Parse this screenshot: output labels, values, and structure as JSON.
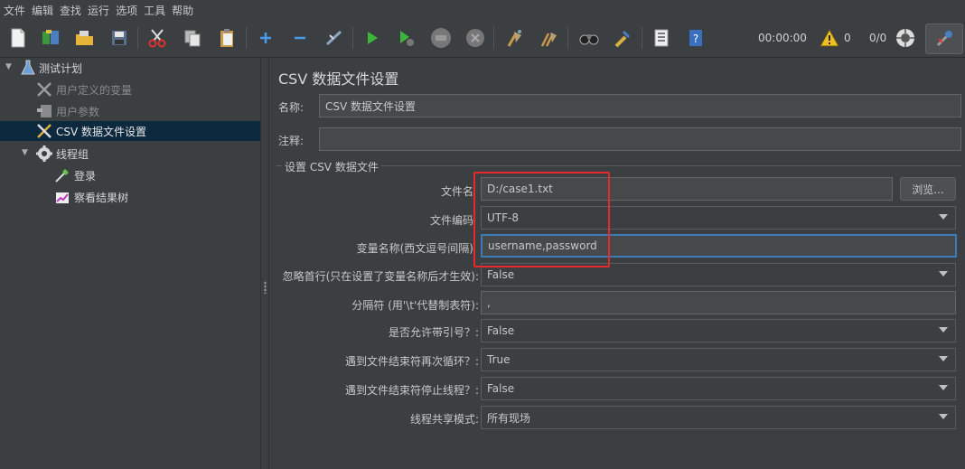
{
  "menu": [
    "文件",
    "编辑",
    "查找",
    "运行",
    "选项",
    "工具",
    "帮助"
  ],
  "toolbar": {
    "timer": "00:00:00",
    "warning_count": "0",
    "thread_count": "0/0"
  },
  "tree": {
    "items": [
      {
        "label": "测试计划"
      },
      {
        "label": "用户定义的变量"
      },
      {
        "label": "用户参数"
      },
      {
        "label": "CSV 数据文件设置"
      },
      {
        "label": "线程组"
      },
      {
        "label": "登录"
      },
      {
        "label": "察看结果树"
      }
    ]
  },
  "panel": {
    "title": "CSV 数据文件设置",
    "name_label": "名称:",
    "name_value": "CSV 数据文件设置",
    "comment_label": "注释:",
    "comment_value": "",
    "group_title": "设置 CSV 数据文件",
    "browse_button": "浏览...",
    "fields": [
      {
        "label": "文件名",
        "value": "D:/case1.txt"
      },
      {
        "label": "文件编码",
        "value": "UTF-8"
      },
      {
        "label": "变量名称(西文逗号间隔)",
        "value": "username,password"
      },
      {
        "label": "忽略首行(只在设置了变量名称后才生效):",
        "value": "False"
      },
      {
        "label": "分隔符 (用'\\t'代替制表符):",
        "value": ","
      },
      {
        "label": "是否允许带引号？:",
        "value": "False"
      },
      {
        "label": "遇到文件结束符再次循环？:",
        "value": "True"
      },
      {
        "label": "遇到文件结束符停止线程？:",
        "value": "False"
      },
      {
        "label": "线程共享模式:",
        "value": "所有现场"
      }
    ]
  },
  "colors": {
    "background": "#3c3f41",
    "selection": "#0d293e",
    "highlight": "#e52a2a",
    "focus": "#3d7ab8"
  }
}
